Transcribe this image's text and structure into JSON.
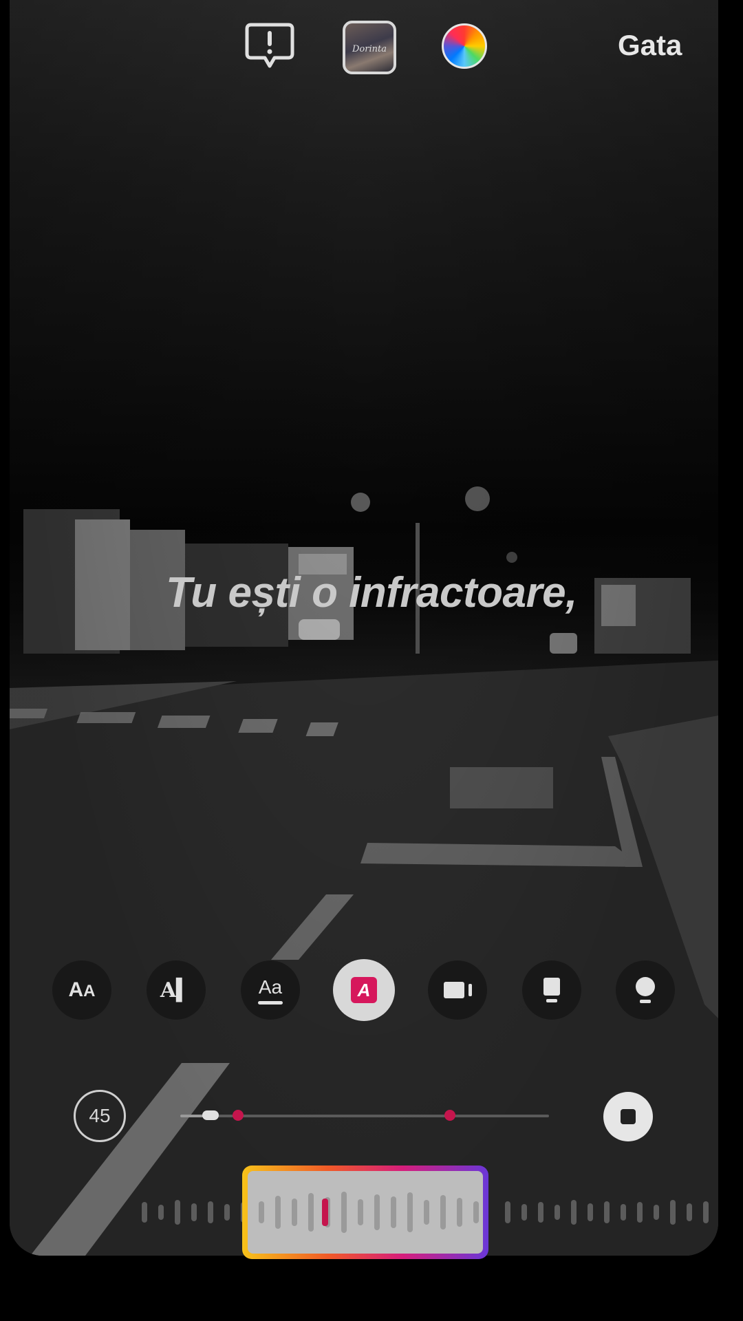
{
  "topbar": {
    "report_icon": "exclamation-bubble-icon",
    "music_thumbnail_text": "Dorinta",
    "color_icon": "color-wheel-icon",
    "done_label": "Gata"
  },
  "caption": {
    "text": "Tu ești o infractoare,"
  },
  "style_toolbar": {
    "items": [
      {
        "name": "style-aa-icon",
        "label": "AA"
      },
      {
        "name": "style-ai-icon",
        "label": "AI"
      },
      {
        "name": "style-underline-aa-icon",
        "label": "Aa"
      },
      {
        "name": "style-highlight-a-icon",
        "label": "A",
        "selected": true
      },
      {
        "name": "style-screen-icon",
        "label": ""
      },
      {
        "name": "style-monitor-icon",
        "label": ""
      },
      {
        "name": "style-bulb-icon",
        "label": ""
      }
    ],
    "selected_color": "#d6175c"
  },
  "timeline": {
    "counter": "45",
    "progress": 0.08,
    "stop_icon": "stop-icon"
  },
  "colors": {
    "accent": "#c5154d",
    "selector_gradient": [
      "#f7c21a",
      "#f05a28",
      "#d61e7b",
      "#6a37d8"
    ]
  }
}
